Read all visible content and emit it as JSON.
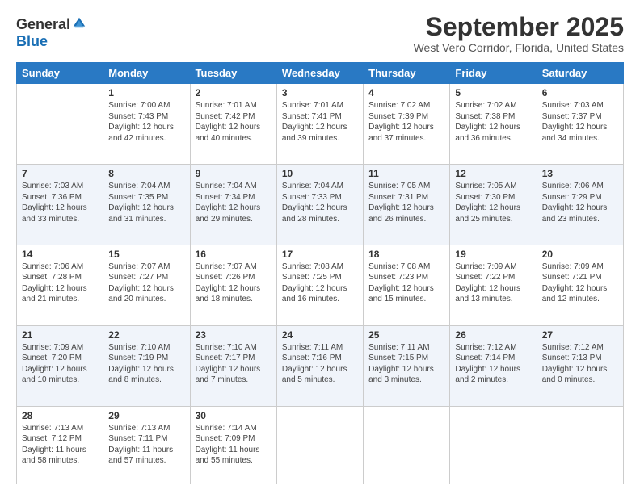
{
  "logo": {
    "general": "General",
    "blue": "Blue"
  },
  "title": "September 2025",
  "location": "West Vero Corridor, Florida, United States",
  "days_of_week": [
    "Sunday",
    "Monday",
    "Tuesday",
    "Wednesday",
    "Thursday",
    "Friday",
    "Saturday"
  ],
  "weeks": [
    [
      {
        "day": "",
        "info": ""
      },
      {
        "day": "1",
        "info": "Sunrise: 7:00 AM\nSunset: 7:43 PM\nDaylight: 12 hours\nand 42 minutes."
      },
      {
        "day": "2",
        "info": "Sunrise: 7:01 AM\nSunset: 7:42 PM\nDaylight: 12 hours\nand 40 minutes."
      },
      {
        "day": "3",
        "info": "Sunrise: 7:01 AM\nSunset: 7:41 PM\nDaylight: 12 hours\nand 39 minutes."
      },
      {
        "day": "4",
        "info": "Sunrise: 7:02 AM\nSunset: 7:39 PM\nDaylight: 12 hours\nand 37 minutes."
      },
      {
        "day": "5",
        "info": "Sunrise: 7:02 AM\nSunset: 7:38 PM\nDaylight: 12 hours\nand 36 minutes."
      },
      {
        "day": "6",
        "info": "Sunrise: 7:03 AM\nSunset: 7:37 PM\nDaylight: 12 hours\nand 34 minutes."
      }
    ],
    [
      {
        "day": "7",
        "info": "Sunrise: 7:03 AM\nSunset: 7:36 PM\nDaylight: 12 hours\nand 33 minutes."
      },
      {
        "day": "8",
        "info": "Sunrise: 7:04 AM\nSunset: 7:35 PM\nDaylight: 12 hours\nand 31 minutes."
      },
      {
        "day": "9",
        "info": "Sunrise: 7:04 AM\nSunset: 7:34 PM\nDaylight: 12 hours\nand 29 minutes."
      },
      {
        "day": "10",
        "info": "Sunrise: 7:04 AM\nSunset: 7:33 PM\nDaylight: 12 hours\nand 28 minutes."
      },
      {
        "day": "11",
        "info": "Sunrise: 7:05 AM\nSunset: 7:31 PM\nDaylight: 12 hours\nand 26 minutes."
      },
      {
        "day": "12",
        "info": "Sunrise: 7:05 AM\nSunset: 7:30 PM\nDaylight: 12 hours\nand 25 minutes."
      },
      {
        "day": "13",
        "info": "Sunrise: 7:06 AM\nSunset: 7:29 PM\nDaylight: 12 hours\nand 23 minutes."
      }
    ],
    [
      {
        "day": "14",
        "info": "Sunrise: 7:06 AM\nSunset: 7:28 PM\nDaylight: 12 hours\nand 21 minutes."
      },
      {
        "day": "15",
        "info": "Sunrise: 7:07 AM\nSunset: 7:27 PM\nDaylight: 12 hours\nand 20 minutes."
      },
      {
        "day": "16",
        "info": "Sunrise: 7:07 AM\nSunset: 7:26 PM\nDaylight: 12 hours\nand 18 minutes."
      },
      {
        "day": "17",
        "info": "Sunrise: 7:08 AM\nSunset: 7:25 PM\nDaylight: 12 hours\nand 16 minutes."
      },
      {
        "day": "18",
        "info": "Sunrise: 7:08 AM\nSunset: 7:23 PM\nDaylight: 12 hours\nand 15 minutes."
      },
      {
        "day": "19",
        "info": "Sunrise: 7:09 AM\nSunset: 7:22 PM\nDaylight: 12 hours\nand 13 minutes."
      },
      {
        "day": "20",
        "info": "Sunrise: 7:09 AM\nSunset: 7:21 PM\nDaylight: 12 hours\nand 12 minutes."
      }
    ],
    [
      {
        "day": "21",
        "info": "Sunrise: 7:09 AM\nSunset: 7:20 PM\nDaylight: 12 hours\nand 10 minutes."
      },
      {
        "day": "22",
        "info": "Sunrise: 7:10 AM\nSunset: 7:19 PM\nDaylight: 12 hours\nand 8 minutes."
      },
      {
        "day": "23",
        "info": "Sunrise: 7:10 AM\nSunset: 7:17 PM\nDaylight: 12 hours\nand 7 minutes."
      },
      {
        "day": "24",
        "info": "Sunrise: 7:11 AM\nSunset: 7:16 PM\nDaylight: 12 hours\nand 5 minutes."
      },
      {
        "day": "25",
        "info": "Sunrise: 7:11 AM\nSunset: 7:15 PM\nDaylight: 12 hours\nand 3 minutes."
      },
      {
        "day": "26",
        "info": "Sunrise: 7:12 AM\nSunset: 7:14 PM\nDaylight: 12 hours\nand 2 minutes."
      },
      {
        "day": "27",
        "info": "Sunrise: 7:12 AM\nSunset: 7:13 PM\nDaylight: 12 hours\nand 0 minutes."
      }
    ],
    [
      {
        "day": "28",
        "info": "Sunrise: 7:13 AM\nSunset: 7:12 PM\nDaylight: 11 hours\nand 58 minutes."
      },
      {
        "day": "29",
        "info": "Sunrise: 7:13 AM\nSunset: 7:11 PM\nDaylight: 11 hours\nand 57 minutes."
      },
      {
        "day": "30",
        "info": "Sunrise: 7:14 AM\nSunset: 7:09 PM\nDaylight: 11 hours\nand 55 minutes."
      },
      {
        "day": "",
        "info": ""
      },
      {
        "day": "",
        "info": ""
      },
      {
        "day": "",
        "info": ""
      },
      {
        "day": "",
        "info": ""
      }
    ]
  ]
}
